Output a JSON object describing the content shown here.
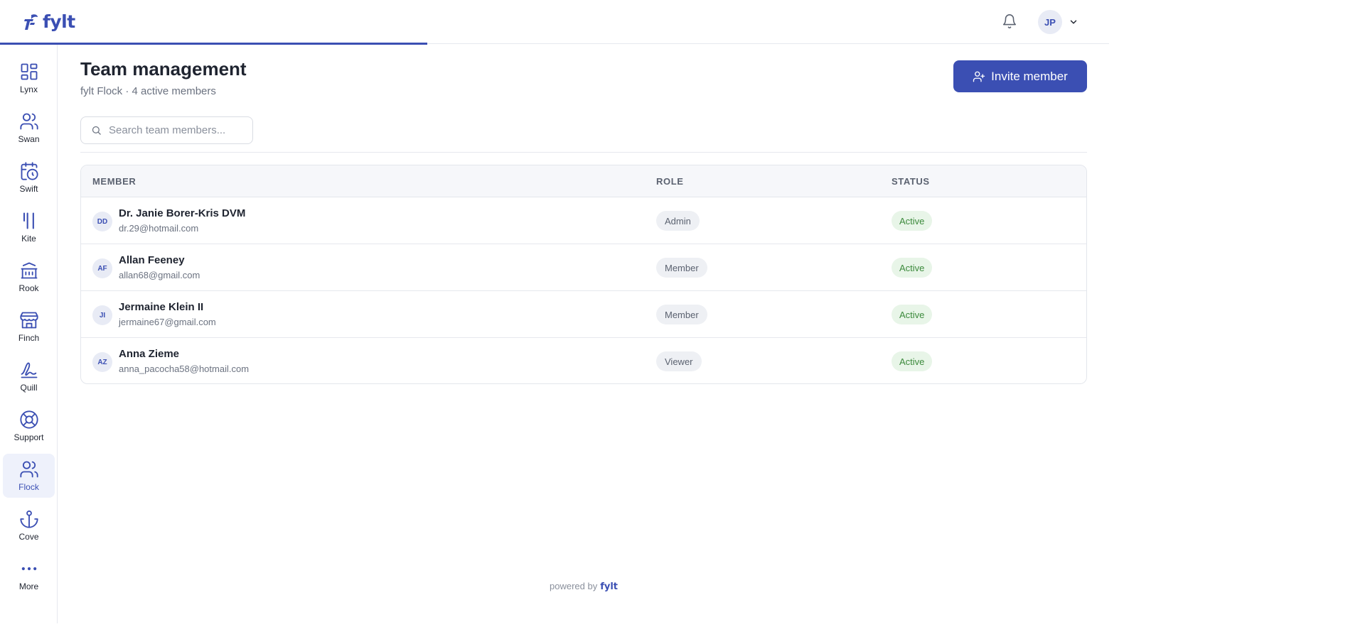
{
  "brand": {
    "name": "fylt",
    "color": "#3b4fb3"
  },
  "header": {
    "user_initials": "JP",
    "progress_fraction": 0.385,
    "icons": [
      "bell-icon",
      "chevron-down-icon"
    ]
  },
  "sidebar": {
    "items": [
      {
        "label": "Lynx",
        "icon": "grid-icon",
        "active": false
      },
      {
        "label": "Swan",
        "icon": "users-icon",
        "active": false
      },
      {
        "label": "Swift",
        "icon": "calendar-clock-icon",
        "active": false
      },
      {
        "label": "Kite",
        "icon": "utensils-icon",
        "active": false
      },
      {
        "label": "Rook",
        "icon": "bank-icon",
        "active": false
      },
      {
        "label": "Finch",
        "icon": "store-icon",
        "active": false
      },
      {
        "label": "Quill",
        "icon": "signature-icon",
        "active": false
      },
      {
        "label": "Support",
        "icon": "lifebuoy-icon",
        "active": false
      },
      {
        "label": "Flock",
        "icon": "users-icon",
        "active": true
      },
      {
        "label": "Cove",
        "icon": "anchor-icon",
        "active": false
      },
      {
        "label": "More",
        "icon": "more-dots-icon",
        "active": false
      }
    ]
  },
  "main": {
    "title": "Team management",
    "subtitle": "fylt Flock · 4 active members",
    "invite_label": "Invite member",
    "search_placeholder": "Search team members..."
  },
  "table": {
    "columns": [
      "MEMBER",
      "ROLE",
      "STATUS"
    ],
    "rows": [
      {
        "initials": "DD",
        "name": "Dr. Janie Borer-Kris DVM",
        "email": "dr.29@hotmail.com",
        "role": "Admin",
        "status": "Active"
      },
      {
        "initials": "AF",
        "name": "Allan Feeney",
        "email": "allan68@gmail.com",
        "role": "Member",
        "status": "Active"
      },
      {
        "initials": "JI",
        "name": "Jermaine Klein II",
        "email": "jermaine67@gmail.com",
        "role": "Member",
        "status": "Active"
      },
      {
        "initials": "AZ",
        "name": "Anna Zieme",
        "email": "anna_pacocha58@hotmail.com",
        "role": "Viewer",
        "status": "Active"
      }
    ]
  },
  "footer": {
    "powered_by": "powered by",
    "brand": "fylt"
  }
}
